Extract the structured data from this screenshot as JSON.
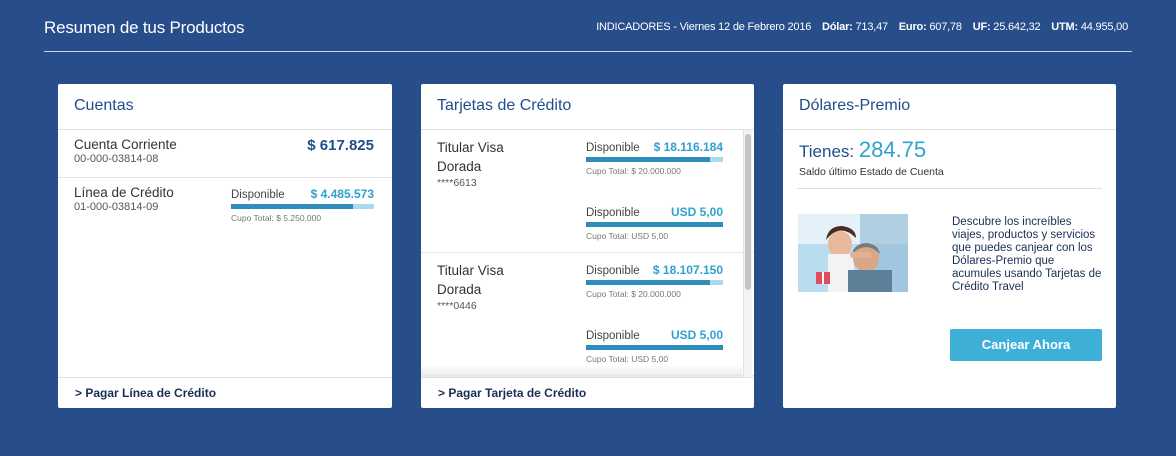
{
  "header": {
    "title": "Resumen de tus Productos",
    "indicators": {
      "prefix": "INDICADORES - Viernes 12 de Febrero 2016",
      "dolar_label": "Dólar:",
      "dolar_value": "713,47",
      "euro_label": "Euro:",
      "euro_value": "607,78",
      "uf_label": "UF:",
      "uf_value": "25.642,32",
      "utm_label": "UTM:",
      "utm_value": "44.955,00"
    }
  },
  "cuentas": {
    "title": "Cuentas",
    "accounts": [
      {
        "name": "Cuenta Corriente",
        "number": "00-000-03814-08",
        "amount": "$ 617.825"
      },
      {
        "name": "Línea de Crédito",
        "number": "01-000-03814-09",
        "available_label": "Disponible",
        "available_value": "$ 4.485.573",
        "cupo": "Cupo Total: $ 5.250.000",
        "fill": 0.85
      }
    ],
    "footer_link": "> Pagar Línea de Crédito"
  },
  "tarjetas": {
    "title": "Tarjetas de Crédito",
    "cards": [
      {
        "name": "Titular Visa Dorada",
        "number": "****6613",
        "national": {
          "label": "Disponible",
          "value": "$ 18.116.184",
          "cupo": "Cupo Total: $ 20.000.000",
          "fill": 0.906
        },
        "international": {
          "label": "Disponible",
          "value": "USD 5,00",
          "cupo": "Cupo Total: USD 5,00",
          "fill": 1.0
        }
      },
      {
        "name": "Titular Visa Dorada",
        "number": "****0446",
        "national": {
          "label": "Disponible",
          "value": "$ 18.107.150",
          "cupo": "Cupo Total: $ 20.000.000",
          "fill": 0.905
        },
        "international": {
          "label": "Disponible",
          "value": "USD 5,00",
          "cupo": "Cupo Total: USD 5,00",
          "fill": 1.0
        }
      }
    ],
    "footer_link": "> Pagar Tarjeta de Crédito"
  },
  "premio": {
    "title": "Dólares-Premio",
    "tienes_label": "Tienes:",
    "tienes_value": "284.75",
    "saldo_text": "Saldo último Estado de Cuenta",
    "promo_text": "Descubre los increíbles viajes, productos y servicios que puedes canjear con los Dólares-Premio que acumules usando Tarjetas de Crédito Travel",
    "cta_label": "Canjear Ahora"
  },
  "colors": {
    "background": "#274d8a",
    "title_blue": "#1f4e8c",
    "accent": "#2ea2cf",
    "button": "#3eb0d8"
  }
}
